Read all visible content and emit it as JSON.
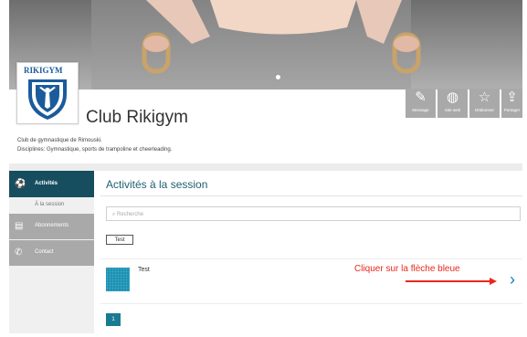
{
  "header": {
    "logo_text": "RIKIGYM",
    "club_name": "Club Rikigym",
    "description_line1": "Club de gymnastique de Rimouski.",
    "description_line2": "Disciplines: Gymnastique, sports de trampoline et cheerleading."
  },
  "actions": [
    {
      "label": "Message",
      "icon": "pencil-icon",
      "glyph": "✎"
    },
    {
      "label": "Site web",
      "icon": "globe-icon",
      "glyph": "◍"
    },
    {
      "label": "M'abonner",
      "icon": "star-icon",
      "glyph": "☆"
    },
    {
      "label": "Partager",
      "icon": "share-icon",
      "glyph": "⇪"
    }
  ],
  "sidebar": {
    "items": [
      {
        "label": "Activités",
        "icon": "soccer-ball-icon",
        "glyph": "⚽"
      },
      {
        "label": "À la session"
      },
      {
        "label": "Abonnements",
        "icon": "id-card-icon",
        "glyph": "▤"
      },
      {
        "label": "Contact",
        "icon": "phone-icon",
        "glyph": "✆"
      }
    ]
  },
  "main": {
    "title": "Activités à la session",
    "search_placeholder": "Recherche",
    "filter_tag": "Test",
    "activities": [
      {
        "name": "Test"
      }
    ],
    "annotation": "Cliquer sur la flèche bleue",
    "chevron": "›",
    "pagination": [
      "1"
    ]
  },
  "colors": {
    "accent": "#1a7a91",
    "sidebar_active": "#164e5f",
    "sidebar_item": "#a9a9a9",
    "annotation": "#e8281c",
    "chevron": "#1a7bbf"
  }
}
